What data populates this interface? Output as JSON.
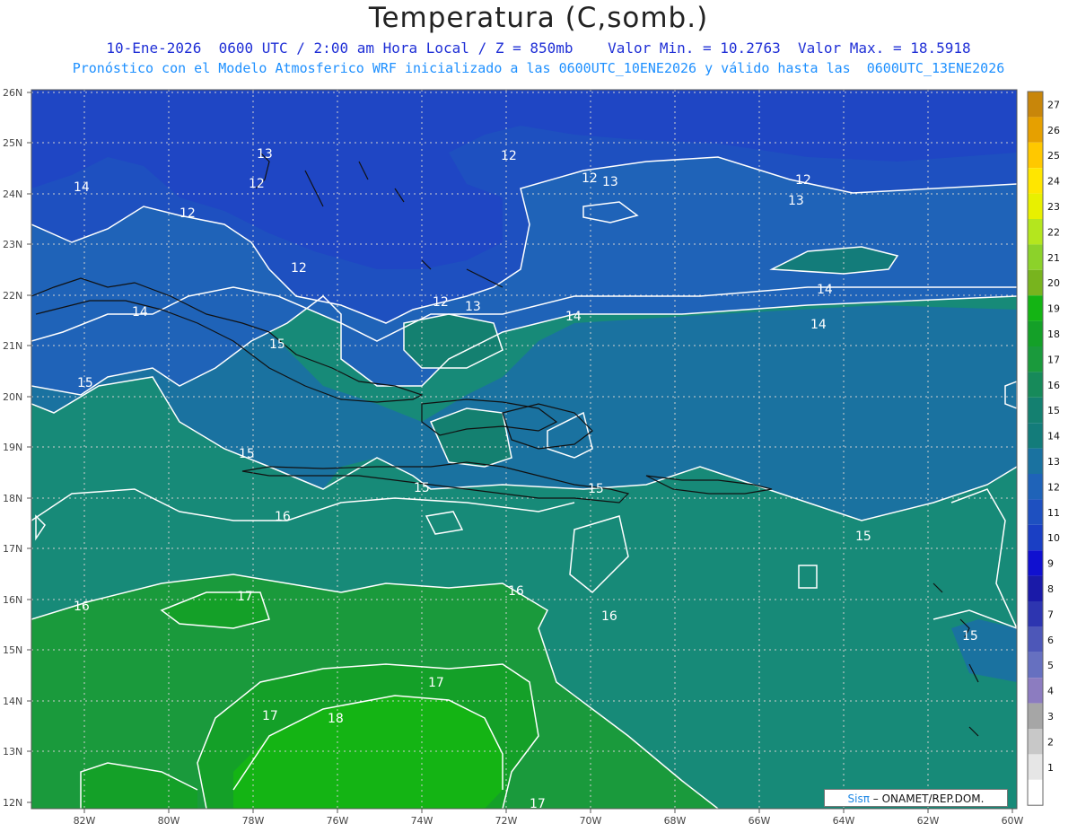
{
  "header": {
    "title": "Temperatura (C,somb.)",
    "line1": "10-Ene-2026  0600 UTC / 2:00 am Hora Local / Z = 850mb    Valor Min. = 10.2763  Valor Max. = 18.5918",
    "line2": "Pronóstico con el Modelo Atmosferico WRF inicializado a las 0600UTC_10ENE2026 y válido hasta las  0600UTC_13ENE2026"
  },
  "axes": {
    "lat_labels": [
      "26N",
      "25N",
      "24N",
      "23N",
      "22N",
      "21N",
      "20N",
      "19N",
      "18N",
      "17N",
      "16N",
      "15N",
      "14N",
      "13N",
      "12N"
    ],
    "lon_labels": [
      "82W",
      "80W",
      "78W",
      "76W",
      "74W",
      "72W",
      "70W",
      "68W",
      "66W",
      "64W",
      "62W",
      "60W"
    ]
  },
  "colorbar": {
    "labels": [
      "27",
      "26",
      "25",
      "24",
      "23",
      "22",
      "21",
      "20",
      "19",
      "18",
      "17",
      "16",
      "15",
      "14",
      "13",
      "12",
      "11",
      "10",
      "9",
      "8",
      "7",
      "6",
      "5",
      "4",
      "3",
      "2",
      "1"
    ],
    "colors": [
      "#c8860a",
      "#e6a000",
      "#ffc800",
      "#ffe600",
      "#e8f000",
      "#b4e61e",
      "#8cd22a",
      "#78b41e",
      "#14b414",
      "#14a028",
      "#1a9a3c",
      "#178a5a",
      "#148070",
      "#137c7a",
      "#1a72a0",
      "#1f63b8",
      "#1e50c0",
      "#1a3fc4",
      "#1010d0",
      "#1a1aa8",
      "#2d35b0",
      "#4d57b8",
      "#6670c0",
      "#8c7cc0",
      "#a6a6a6",
      "#c8c8c8",
      "#e6e6e6"
    ],
    "bottom_color": "#ffffff"
  },
  "contour_labels": [
    "12",
    "12",
    "12",
    "12",
    "12",
    "12",
    "12",
    "13",
    "13",
    "13",
    "13",
    "14",
    "14",
    "14",
    "14",
    "14",
    "15",
    "15",
    "15",
    "15",
    "15",
    "15",
    "15",
    "16",
    "16",
    "16",
    "16",
    "17",
    "17",
    "17",
    "17",
    "18"
  ],
  "credit": {
    "brand": "Sisπ",
    "text": " – ONAMET/REP.DOM."
  }
}
